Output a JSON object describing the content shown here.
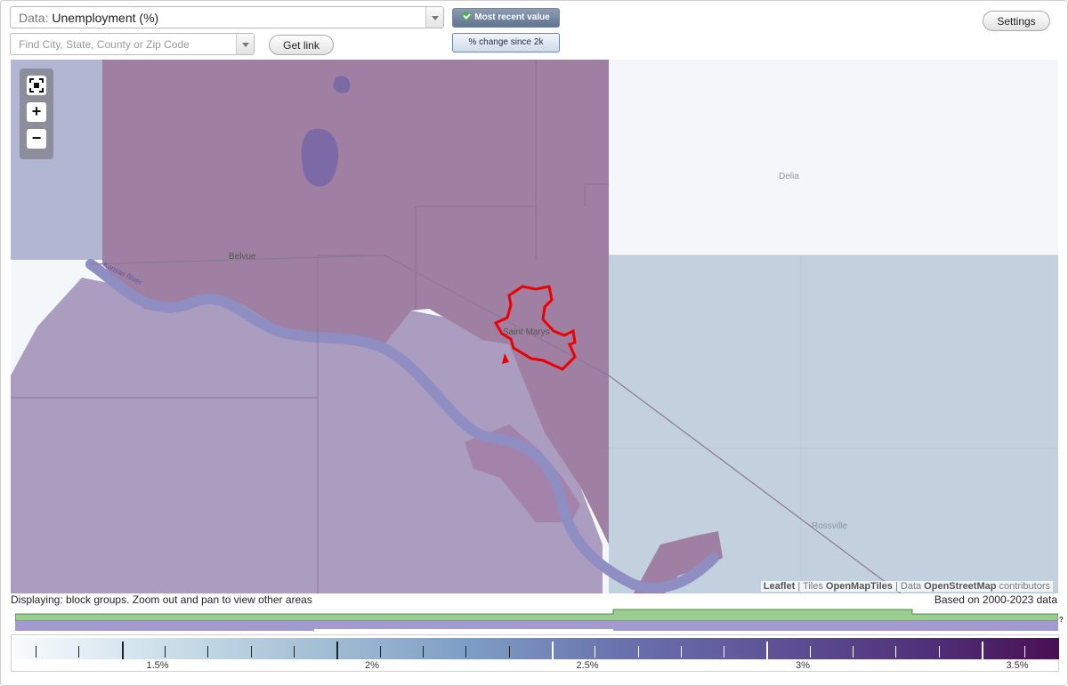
{
  "controls": {
    "data_select_prefix": "Data:",
    "data_select_value": "Unemployment (%)",
    "find_placeholder": "Find City, State, County or Zip Code",
    "get_link_label": "Get link",
    "mode_active_label": "Most recent value",
    "mode_inactive_label": "% change since 2k",
    "settings_label": "Settings"
  },
  "map": {
    "place_labels": [
      "Belvue",
      "Saint Marys",
      "Delia",
      "Rossville"
    ],
    "river_label": "Kansas River",
    "zoom": {
      "fit": "fit-bounds",
      "plus": "+",
      "minus": "−"
    },
    "attribution": {
      "leaflet": "Leaflet",
      "sep1": " | Tiles ",
      "tiles": "OpenMapTiles",
      "sep2": " | Data ",
      "data": "OpenStreetMap",
      "contributors": " contributors"
    },
    "colors": {
      "dark_region": "#9f7fa2",
      "mid_region": "#a99bbd",
      "light_region": "#c3d0de",
      "pale_region": "#f4f7f9",
      "river": "#8e8ec3",
      "highlight_outline": "#ee0000"
    }
  },
  "status": {
    "displaying": "Displaying: block groups. Zoom out and pan to view other areas",
    "based_on": "Based on 2000-2023 data"
  },
  "timeline": {
    "help": "?",
    "colors": {
      "green": "#9acd8f",
      "purple": "#a39bd0"
    }
  },
  "legend": {
    "labels": [
      "1.5%",
      "2%",
      "2.5%",
      "3%",
      "3.5%"
    ],
    "scale_min": 1.25,
    "scale_max": 3.68,
    "major_values": [
      1.5,
      2,
      2.5,
      3,
      3.5
    ],
    "minor_step": 0.1
  }
}
